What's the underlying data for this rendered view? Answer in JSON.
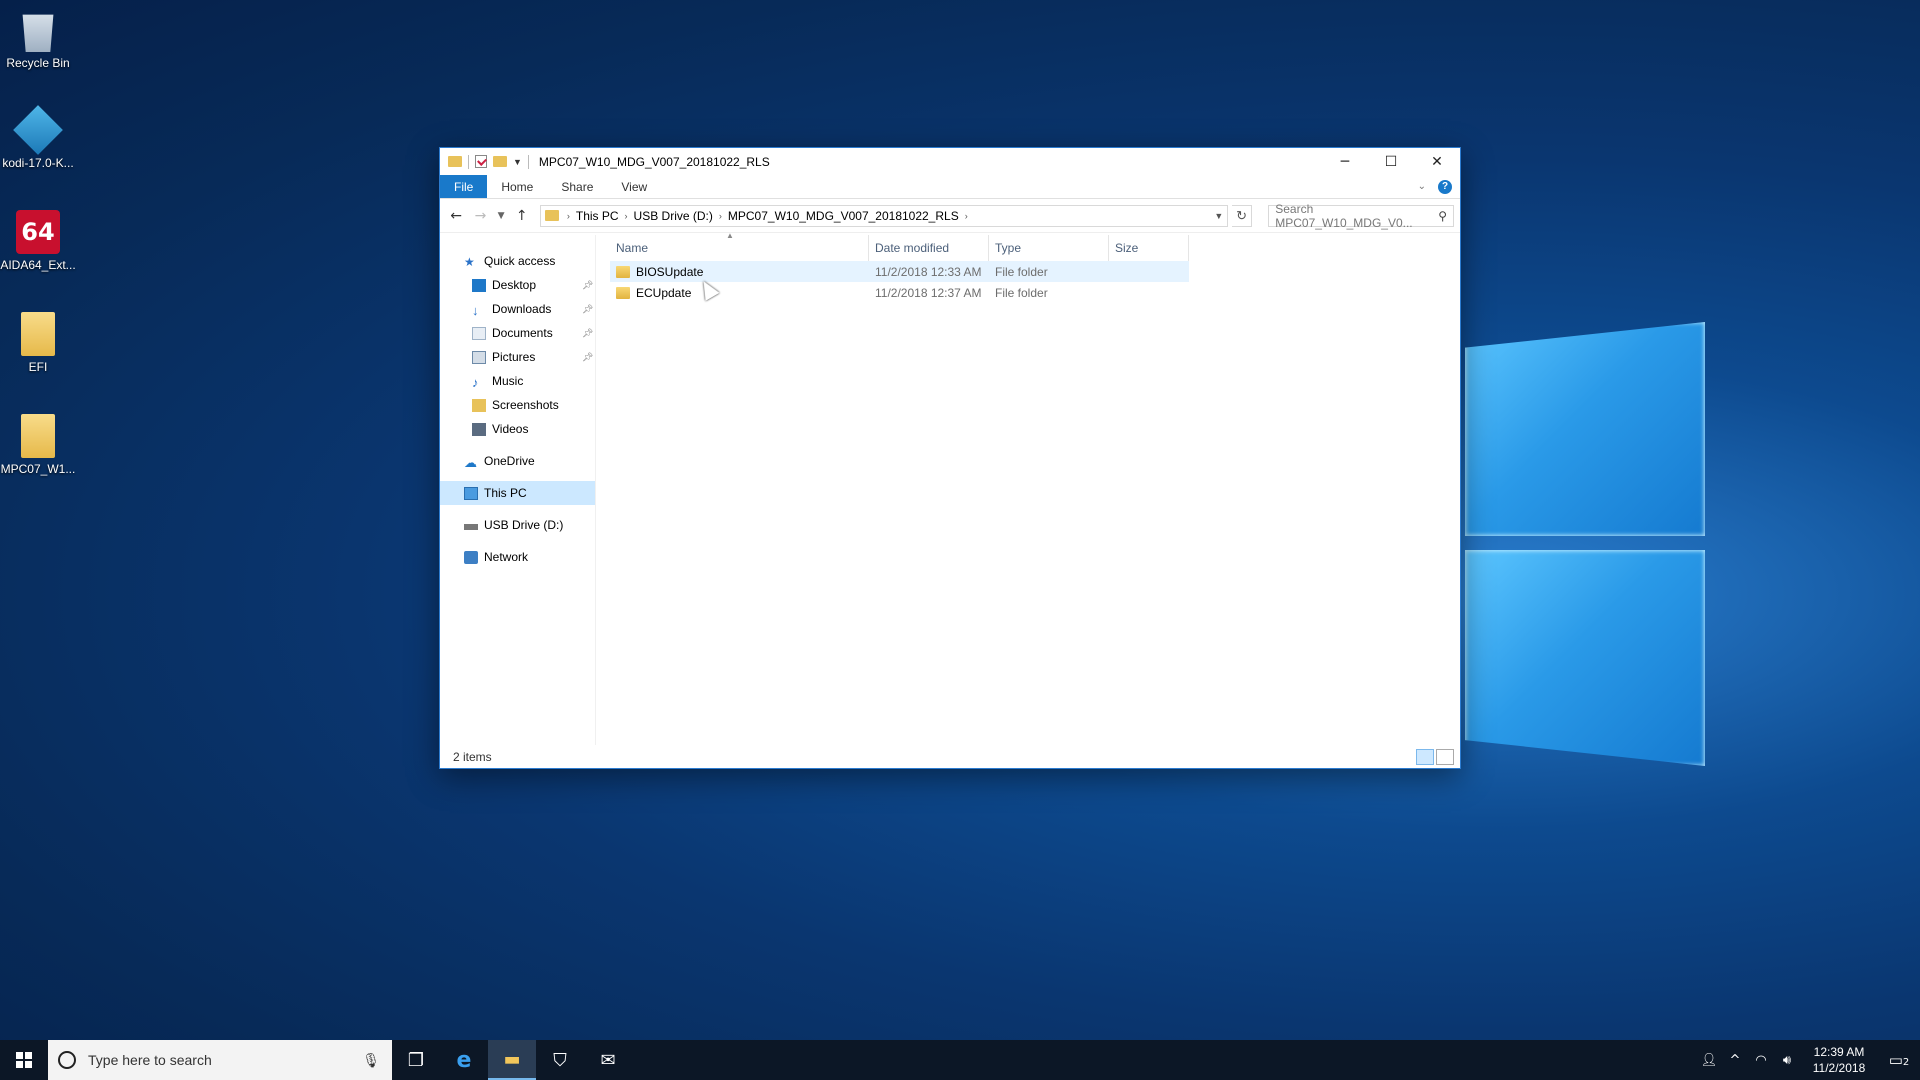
{
  "desktop": {
    "icons": [
      {
        "label": "Recycle Bin",
        "icon": "recycle-bin-icon"
      },
      {
        "label": "kodi-17.0-K...",
        "icon": "kodi-icon"
      },
      {
        "label": "AIDA64_Ext...",
        "icon": "aida64-icon",
        "badge": "64"
      },
      {
        "label": "EFI",
        "icon": "folder-icon"
      },
      {
        "label": "MPC07_W1...",
        "icon": "folder-icon"
      }
    ]
  },
  "window": {
    "title": "MPC07_W10_MDG_V007_20181022_RLS",
    "controls": {
      "minimize": "─",
      "maximize": "☐",
      "close": "✕"
    },
    "ribbon_tabs": [
      "File",
      "Home",
      "Share",
      "View"
    ],
    "help": "?",
    "address": {
      "crumbs": [
        "This PC",
        "USB Drive (D:)",
        "MPC07_W10_MDG_V007_20181022_RLS"
      ]
    },
    "search_placeholder": "Search MPC07_W10_MDG_V0...",
    "nav": {
      "quick_access": "Quick access",
      "pinned": [
        {
          "label": "Desktop",
          "pinned": true,
          "icon": "desktop-icon",
          "color": "#1e78c8"
        },
        {
          "label": "Downloads",
          "pinned": true,
          "icon": "download-icon",
          "color": "#2a72c8"
        },
        {
          "label": "Documents",
          "pinned": true,
          "icon": "documents-icon",
          "color": "#9fb3c8"
        },
        {
          "label": "Pictures",
          "pinned": true,
          "icon": "pictures-icon",
          "color": "#6d8aa8"
        },
        {
          "label": "Music",
          "pinned": false,
          "icon": "music-icon",
          "color": "#2a72c8"
        },
        {
          "label": "Screenshots",
          "pinned": false,
          "icon": "folder-icon",
          "color": "#e8c25a"
        },
        {
          "label": "Videos",
          "pinned": false,
          "icon": "videos-icon",
          "color": "#5a6b80"
        }
      ],
      "onedrive": "OneDrive",
      "this_pc": "This PC",
      "usb": "USB Drive (D:)",
      "network": "Network"
    },
    "columns": [
      "Name",
      "Date modified",
      "Type",
      "Size"
    ],
    "files": [
      {
        "name": "BIOSUpdate",
        "date": "11/2/2018 12:33 AM",
        "type": "File folder",
        "size": ""
      },
      {
        "name": "ECUpdate",
        "date": "11/2/2018 12:37 AM",
        "type": "File folder",
        "size": ""
      }
    ],
    "status": "2 items"
  },
  "taskbar": {
    "search_placeholder": "Type here to search",
    "apps": [
      {
        "name": "task-view",
        "glyph": "❐"
      },
      {
        "name": "edge",
        "glyph": "e"
      },
      {
        "name": "file-explorer",
        "glyph": "▬",
        "active": true
      },
      {
        "name": "store",
        "glyph": "⛉"
      },
      {
        "name": "mail",
        "glyph": "✉"
      }
    ],
    "time": "12:39 AM",
    "date": "11/2/2018",
    "notifications": "2"
  }
}
